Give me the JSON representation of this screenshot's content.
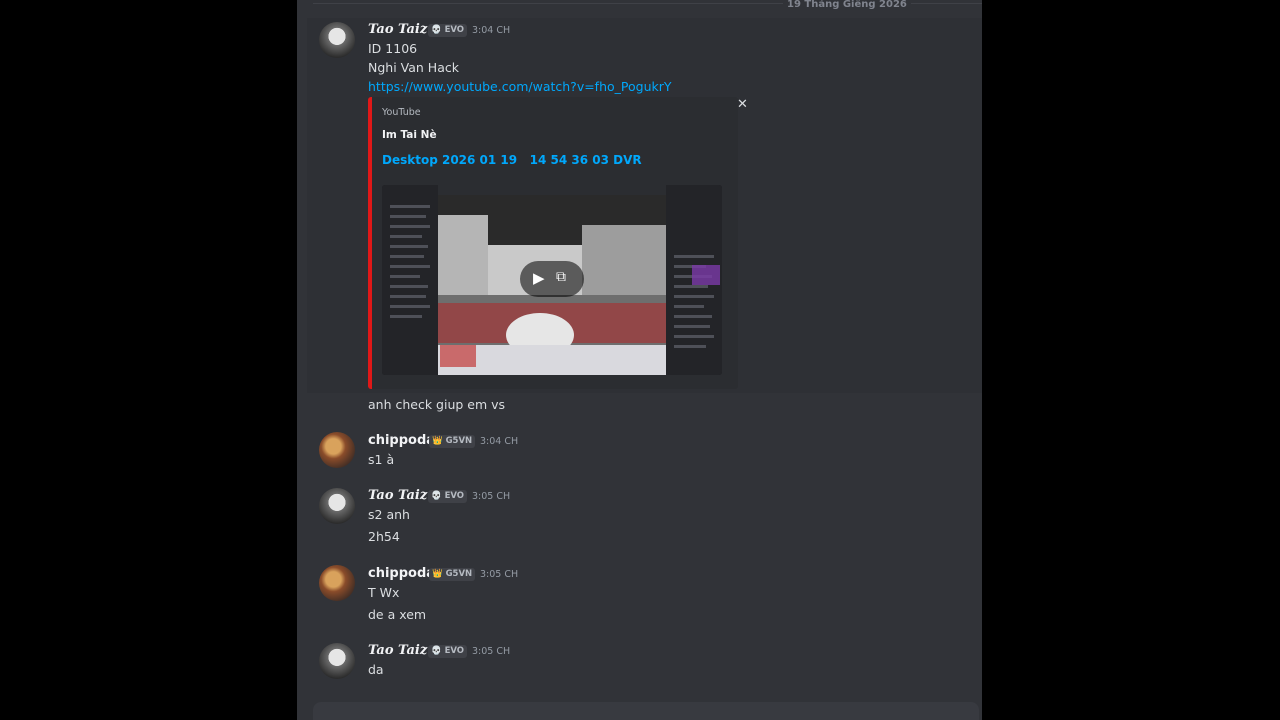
{
  "date_divider": "19 Tháng Giêng 2026",
  "messages": [
    {
      "author": "Tao Taiz",
      "tag": "EVO",
      "time": "3:04 CH",
      "lines": [
        "ID 1106",
        "Nghi Van Hack"
      ],
      "link": "https://www.youtube.com/watch?v=fho_PogukrY",
      "embed": {
        "provider": "YouTube",
        "author": "Im Tai Nè",
        "title": "Desktop 2026 01 19   14 54 36 03 DVR",
        "accent_color": "#e01818"
      },
      "followup": "anh check giup em vs"
    },
    {
      "author": "chippoda",
      "tag": "G5VN",
      "time": "3:04 CH",
      "lines": [
        "s1 à"
      ]
    },
    {
      "author": "Tao Taiz",
      "tag": "EVO",
      "time": "3:05 CH",
      "lines": [
        "s2 anh",
        "2h54"
      ]
    },
    {
      "author": "chippoda",
      "tag": "G5VN",
      "time": "3:05 CH",
      "lines": [
        "T Wx",
        "de a xem"
      ]
    },
    {
      "author": "Tao Taiz",
      "tag": "EVO",
      "time": "3:05 CH",
      "lines": [
        "da"
      ]
    }
  ],
  "icons": {
    "evo_tag_icon": "skull-icon",
    "g5vn_tag_icon": "crown-icon",
    "embed_close": "close-icon",
    "play": "play-icon",
    "popout": "popout-icon"
  },
  "colors": {
    "chat_bg": "#313338",
    "link": "#00a8fc",
    "embed_accent": "#e01818"
  }
}
